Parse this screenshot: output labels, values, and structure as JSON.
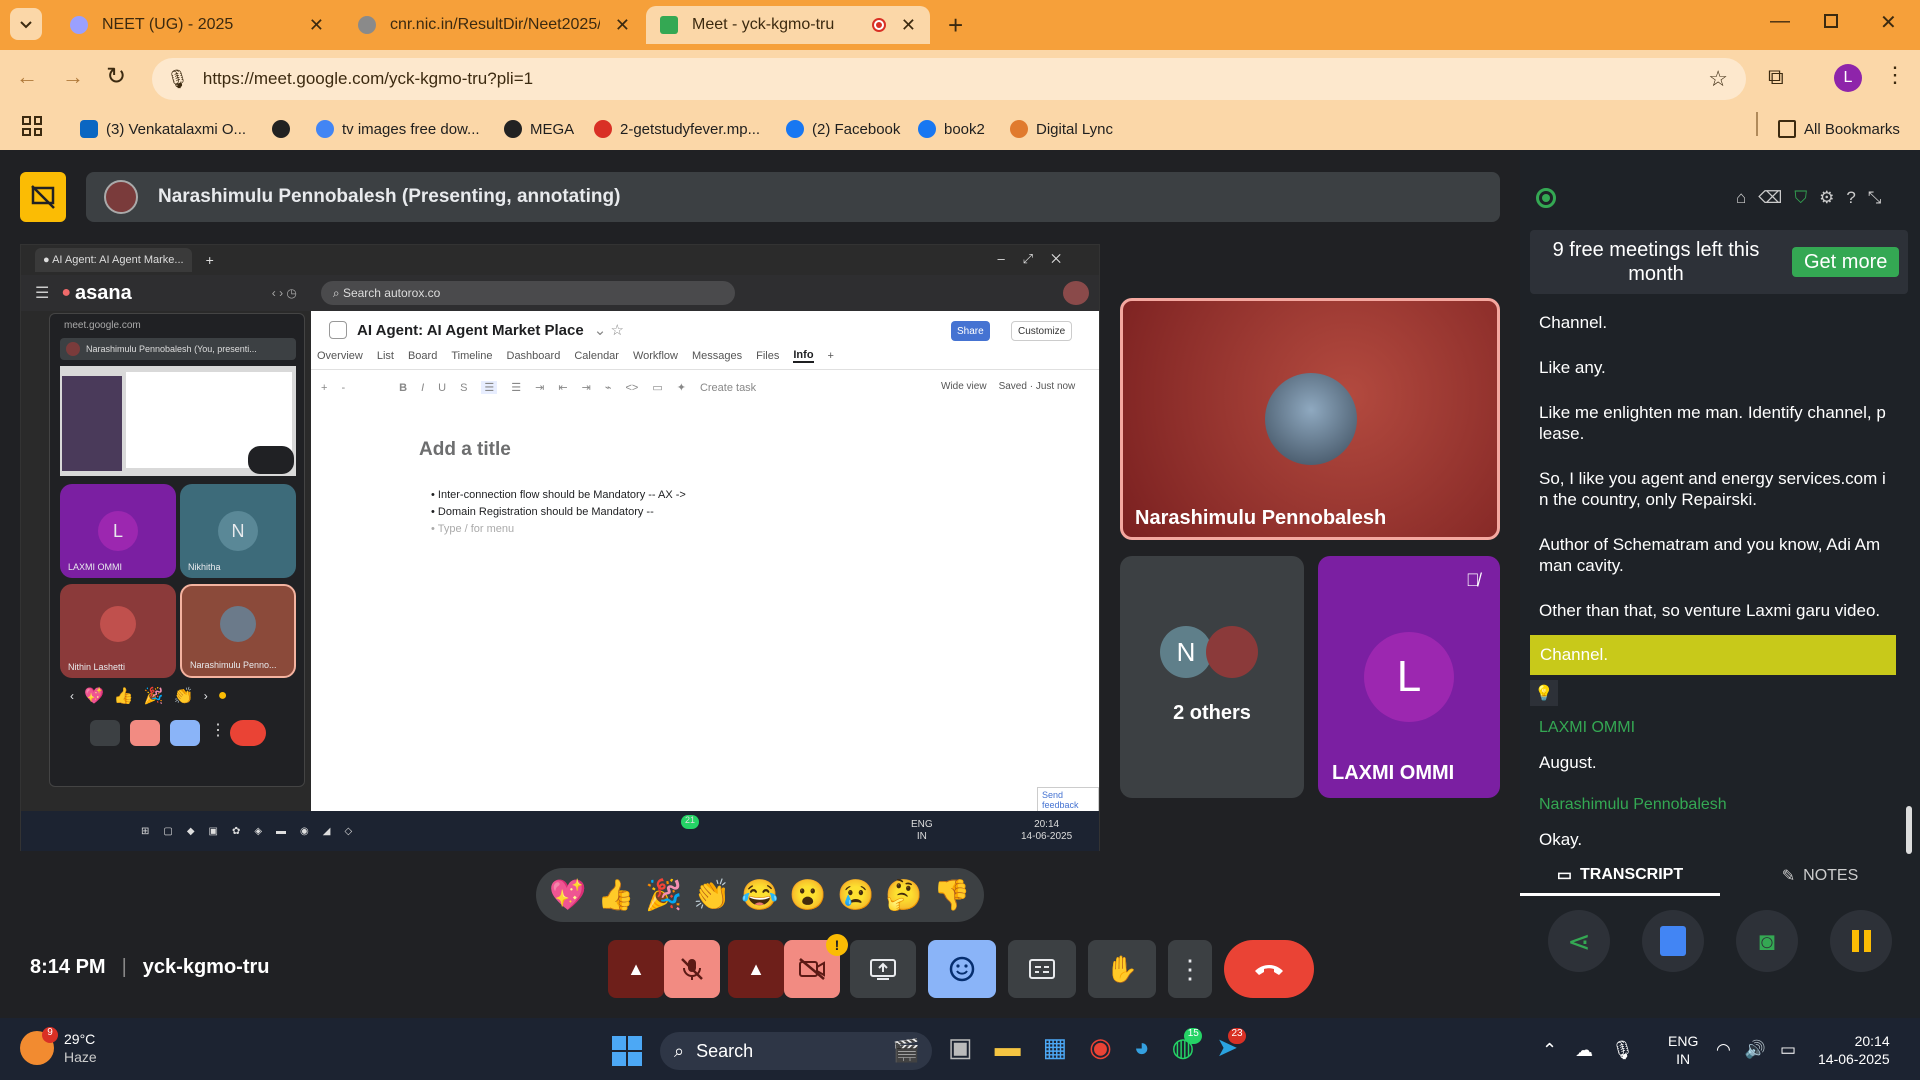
{
  "tabs": [
    {
      "title": "NEET (UG) - 2025",
      "color": "#9aa0ff"
    },
    {
      "title": "cnr.nic.in/ResultDir/Neet2025/L",
      "color": "#8a8a8a"
    },
    {
      "title": "Meet - yck-kgmo-tru",
      "color": "#34a853"
    }
  ],
  "address": {
    "url": "https://meet.google.com/yck-kgmo-tru?pli=1"
  },
  "bookmarks": [
    {
      "label": "(3) Venkatalaxmi O...",
      "color": "#0a66c2"
    },
    {
      "label": "",
      "color": "#222"
    },
    {
      "label": "tv images free dow...",
      "color": "#4285f4"
    },
    {
      "label": "MEGA",
      "color": "#222"
    },
    {
      "label": "2-getstudyfever.mp...",
      "color": "#d93025"
    },
    {
      "label": "(2) Facebook",
      "color": "#1877f2"
    },
    {
      "label": "book2",
      "color": "#1877f2"
    },
    {
      "label": "Digital Lync",
      "color": "#e07a2e"
    }
  ],
  "bookmarks_all": "All Bookmarks",
  "profile_initial": "L",
  "presenter": {
    "label": "Narashimulu Pennobalesh (Presenting, annotating)"
  },
  "shared_screen": {
    "window_tab": "● AI Agent: AI Agent Marke...",
    "app_name": "asana",
    "search": "Search autorox.co",
    "project_title": "AI Agent: AI Agent Market Place",
    "share_btn": "Share",
    "customize_btn": "Customize",
    "tabs": [
      "Overview",
      "List",
      "Board",
      "Timeline",
      "Dashboard",
      "Calendar",
      "Workflow",
      "Messages",
      "Files",
      "Info"
    ],
    "toolbar_right": [
      "Create task",
      "Wide view",
      "Saved · Just now"
    ],
    "doc_title": "Add a title",
    "bullets": [
      "Inter-connection flow should be Mandatory -- AX ->",
      "Domain Registration should be Mandatory --"
    ],
    "bullet_placeholder": "Type / for menu",
    "send_feedback": "Send feedback",
    "mini_meet": {
      "url": "meet.google.com",
      "presenter": "Narashimulu Pennobalesh (You, presenti...",
      "tiles": [
        {
          "name": "LAXMI OMMI",
          "initial": "L"
        },
        {
          "name": "Nikhitha",
          "initial": "N"
        },
        {
          "name": "Nithin Lashetti",
          "initial": ""
        },
        {
          "name": "Narashimulu Penno...",
          "initial": ""
        }
      ]
    },
    "inner_taskbar": {
      "lang": "ENG",
      "lang2": "IN",
      "time": "20:14",
      "date": "14-06-2025",
      "badge": "21"
    }
  },
  "participants": {
    "main": {
      "name": "Narashimulu Pennobalesh"
    },
    "others": {
      "label": "2 others",
      "initial": "N"
    },
    "laxmi": {
      "name": "LAXMI OMMI",
      "initial": "L"
    }
  },
  "reactions": [
    "💖",
    "👍",
    "🎉",
    "👏",
    "😂",
    "😮",
    "😢",
    "🤔",
    "👎"
  ],
  "meeting_info": {
    "time": "8:14 PM",
    "code": "yck-kgmo-tru"
  },
  "side_panel": {
    "promo": "9 free meetings left this month",
    "get_more": "Get more",
    "transcript": [
      "Channel.",
      "Like any.",
      "Like me enlighten me man. Identify channel, p lease.",
      "So, I like you agent and energy services.com i n the country, only Repairski.",
      "Author of Schematram and you know, Adi Am man cavity.",
      "Other than that, so venture Laxmi garu video."
    ],
    "highlight": "Channel.",
    "bulb": "💡",
    "speaker1": "LAXMI OMMI",
    "line1": "August.",
    "speaker2": "Narashimulu Pennobalesh",
    "line2": "Okay.",
    "tab_transcript": "TRANSCRIPT",
    "tab_notes": "NOTES"
  },
  "taskbar": {
    "weather_temp": "29°C",
    "weather_desc": "Haze",
    "weather_badge": "9",
    "search": "Search",
    "lang": "ENG",
    "lang2": "IN",
    "time": "20:14",
    "date": "14-06-2025",
    "whatsapp_badge": "15",
    "telegram_badge": "23"
  }
}
